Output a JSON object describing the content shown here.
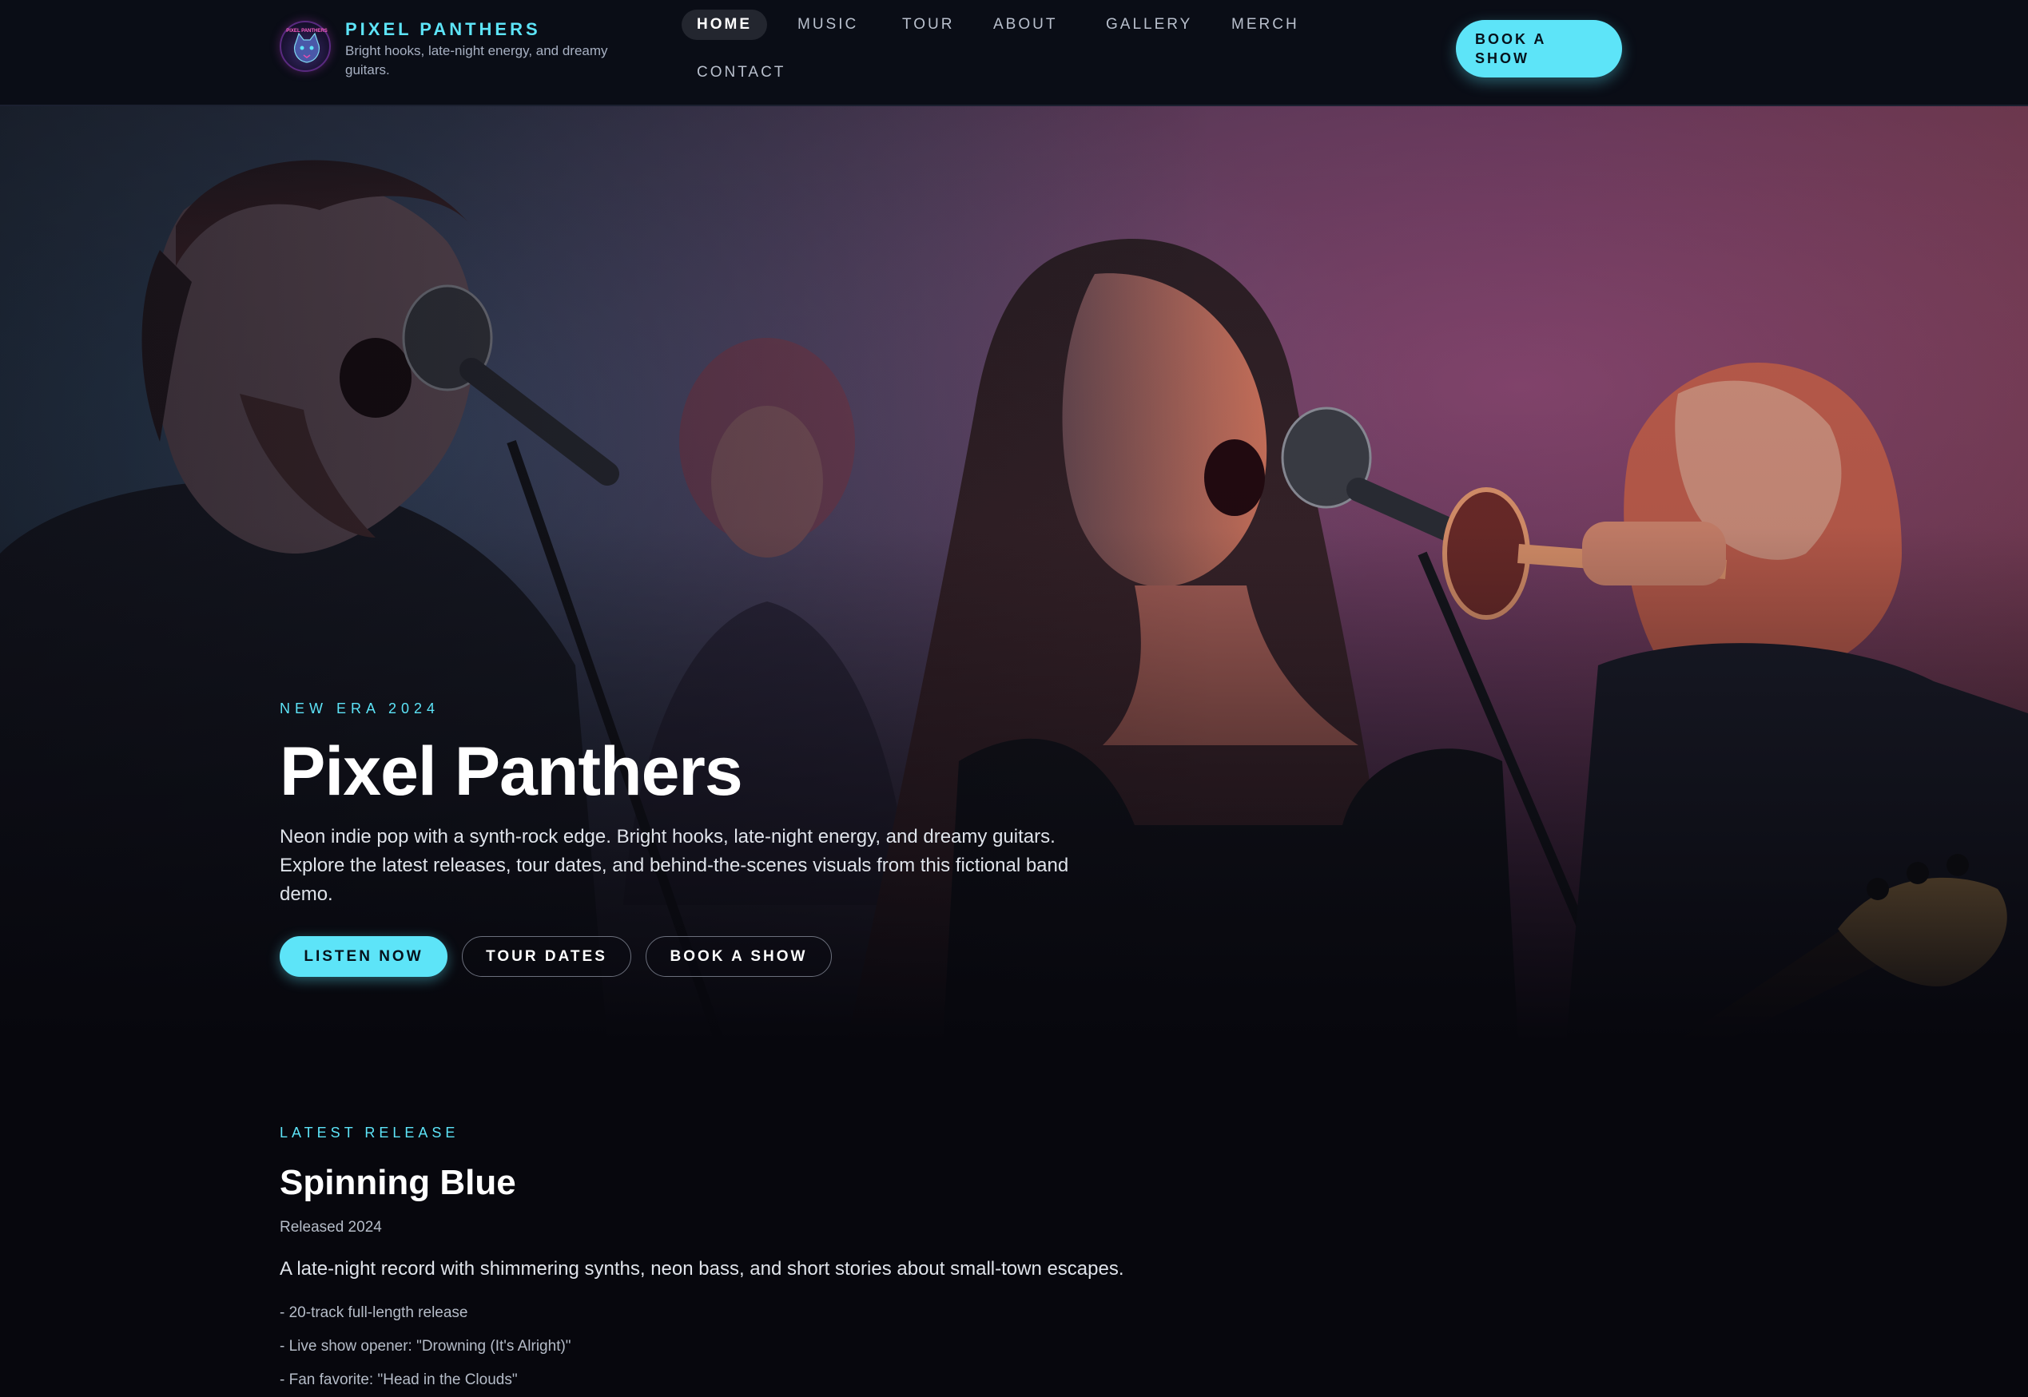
{
  "header": {
    "brand_name": "PIXEL PANTHERS",
    "brand_tagline": "Bright hooks, late-night energy, and dreamy guitars.",
    "logo_text": "PIXEL PANTHERS",
    "logo_icon": "panther-logo-icon",
    "nav": [
      {
        "label": "HOME",
        "active": true
      },
      {
        "label": "MUSIC"
      },
      {
        "label": "TOUR"
      },
      {
        "label": "ABOUT"
      },
      {
        "label": "GALLERY"
      },
      {
        "label": "MERCH"
      },
      {
        "label": "CONTACT"
      }
    ],
    "cta_label": "BOOK A SHOW"
  },
  "hero": {
    "eyebrow": "NEW ERA 2024",
    "title": "Pixel Panthers",
    "description": "Neon indie pop with a synth-rock edge. Bright hooks, late-night energy, and dreamy guitars. Explore the latest releases, tour dates, and behind-the-scenes visuals from this fictional band demo.",
    "buttons": {
      "listen": "LISTEN NOW",
      "tour": "TOUR DATES",
      "book": "BOOK A SHOW"
    }
  },
  "release": {
    "eyebrow": "LATEST RELEASE",
    "title": "Spinning Blue",
    "date": "Released 2024",
    "description": "A late-night record with shimmering synths, neon bass, and short stories about small-town escapes.",
    "highlights": [
      "- 20-track full-length release",
      "- Live show opener: \"Drowning (It's Alright)\"",
      "- Fan favorite: \"Head in the Clouds\""
    ]
  },
  "colors": {
    "accent": "#5de4f8",
    "background": "#07070d",
    "header_bg": "#0a0d16"
  }
}
